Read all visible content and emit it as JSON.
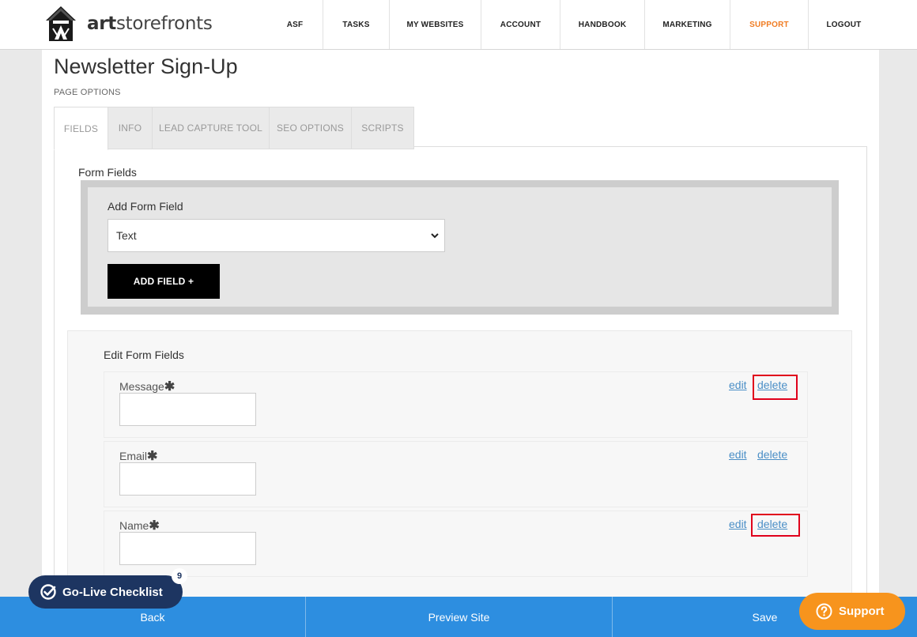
{
  "header": {
    "logo_text_bold": "art",
    "logo_text": "storefronts",
    "nav": [
      {
        "label": "ASF"
      },
      {
        "label": "TASKS"
      },
      {
        "label": "MY WEBSITES"
      },
      {
        "label": "ACCOUNT"
      },
      {
        "label": "HANDBOOK"
      },
      {
        "label": "MARKETING"
      },
      {
        "label": "SUPPORT",
        "active": true
      },
      {
        "label": "LOGOUT"
      }
    ],
    "active_color": "#f07c22"
  },
  "page": {
    "title": "Newsletter Sign-Up",
    "options_label": "PAGE OPTIONS",
    "tabs": [
      {
        "label": "FIELDS",
        "active": true
      },
      {
        "label": "INFO"
      },
      {
        "label": "LEAD CAPTURE TOOL"
      },
      {
        "label": "SEO OPTIONS"
      },
      {
        "label": "SCRIPTS"
      }
    ]
  },
  "form_fields": {
    "section_label": "Form Fields",
    "add_title": "Add Form Field",
    "field_type_selected": "Text",
    "add_button": "ADD FIELD +"
  },
  "edit_fields": {
    "title": "Edit Form Fields",
    "edit_label": "edit",
    "delete_label": "delete",
    "required_mark": "✱",
    "fields": [
      {
        "label": "Message",
        "delete_highlighted": true
      },
      {
        "label": "Email",
        "delete_highlighted": false
      },
      {
        "label": "Name",
        "delete_highlighted": true
      }
    ]
  },
  "bottom_bar": {
    "back": "Back",
    "preview": "Preview Site",
    "save": "Save",
    "color": "#2d8ee0"
  },
  "go_live": {
    "label": "Go-Live Checklist",
    "badge": "9",
    "icon": "check-circle-icon"
  },
  "support_button": {
    "label": "Support",
    "icon": "question-circle-icon",
    "color": "#f7941d"
  }
}
